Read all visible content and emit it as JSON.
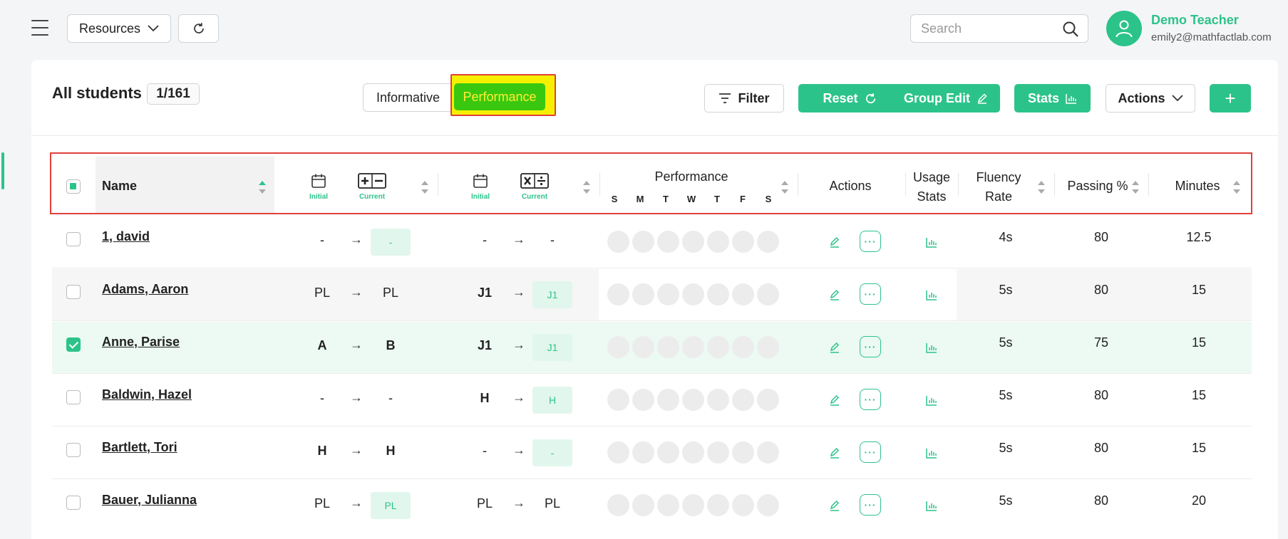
{
  "topbar": {
    "resources_label": "Resources",
    "search_placeholder": "Search",
    "user_name": "Demo Teacher",
    "user_email": "emily2@mathfactlab.com"
  },
  "toolbar": {
    "title": "All students",
    "count": "1/161",
    "view_tabs": [
      "Informative",
      "Performance"
    ],
    "active_view": "Performance",
    "filter": "Filter",
    "reset": "Reset",
    "group_edit": "Group Edit",
    "stats": "Stats",
    "actions": "Actions",
    "add": "+"
  },
  "table": {
    "headers": {
      "name": "Name",
      "initial": "Initial",
      "current": "Current",
      "performance": "Performance",
      "days": [
        "S",
        "M",
        "T",
        "W",
        "T",
        "F",
        "S"
      ],
      "actions": "Actions",
      "usage": "Usage",
      "stats": "Stats",
      "fluency": "Fluency",
      "rate": "Rate",
      "passing": "Passing %",
      "minutes": "Minutes"
    },
    "rows": [
      {
        "name": "1, david",
        "checked": false,
        "add_initial": "-",
        "add_current": "-",
        "mul_initial": "-",
        "mul_current": "-",
        "fluency": "4s",
        "passing": "80",
        "minutes": "12.5"
      },
      {
        "name": "Adams, Aaron",
        "checked": false,
        "add_initial": "PL",
        "add_current": "PL",
        "mul_initial": "J1",
        "mul_current": "J1",
        "fluency": "5s",
        "passing": "80",
        "minutes": "15"
      },
      {
        "name": "Anne, Parise",
        "checked": true,
        "add_initial": "A",
        "add_current": "B",
        "mul_initial": "J1",
        "mul_current": "J1",
        "fluency": "5s",
        "passing": "75",
        "minutes": "15"
      },
      {
        "name": "Baldwin, Hazel",
        "checked": false,
        "add_initial": "-",
        "add_current": "-",
        "mul_initial": "H",
        "mul_current": "H",
        "fluency": "5s",
        "passing": "80",
        "minutes": "15"
      },
      {
        "name": "Bartlett, Tori",
        "checked": false,
        "add_initial": "H",
        "add_current": "H",
        "mul_initial": "-",
        "mul_current": "-",
        "fluency": "5s",
        "passing": "80",
        "minutes": "15"
      },
      {
        "name": "Bauer, Julianna",
        "checked": false,
        "add_initial": "PL",
        "add_current": "PL",
        "mul_initial": "PL",
        "mul_current": "PL",
        "fluency": "5s",
        "passing": "80",
        "minutes": "20"
      }
    ]
  }
}
